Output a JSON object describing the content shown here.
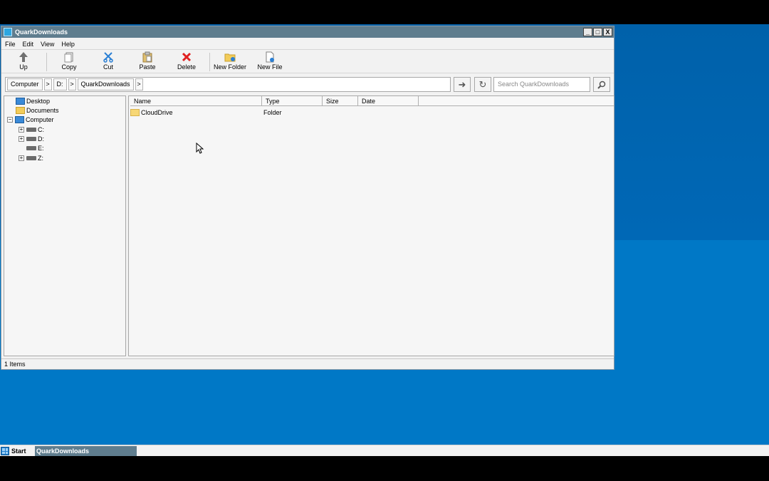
{
  "window": {
    "title": "QuarkDownloads",
    "buttons": {
      "minimize": "_",
      "maximize": "□",
      "close": "X"
    }
  },
  "menu": [
    "File",
    "Edit",
    "View",
    "Help"
  ],
  "toolbar": {
    "up": "Up",
    "copy": "Copy",
    "cut": "Cut",
    "paste": "Paste",
    "delete": "Delete",
    "new_folder": "New Folder",
    "new_file": "New File"
  },
  "address": {
    "crumbs": [
      "Computer",
      "D:",
      "QuarkDownloads"
    ],
    "search_placeholder": "Search QuarkDownloads"
  },
  "tree": {
    "desktop": "Desktop",
    "documents": "Documents",
    "computer": "Computer",
    "drives": [
      "C:",
      "D:",
      "E:",
      "Z:"
    ]
  },
  "list": {
    "columns": [
      "Name",
      "Type",
      "Size",
      "Date"
    ],
    "rows": [
      {
        "name": "CloudDrive",
        "type": "Folder",
        "size": "",
        "date": ""
      }
    ]
  },
  "status": "1 Items",
  "taskbar": {
    "start": "Start",
    "task": "QuarkDownloads"
  },
  "colors": {
    "titlebar": "#5f7d8e",
    "desktop": "#0071bd",
    "delete_red": "#e02020",
    "cut_blue": "#2a7fd4"
  }
}
